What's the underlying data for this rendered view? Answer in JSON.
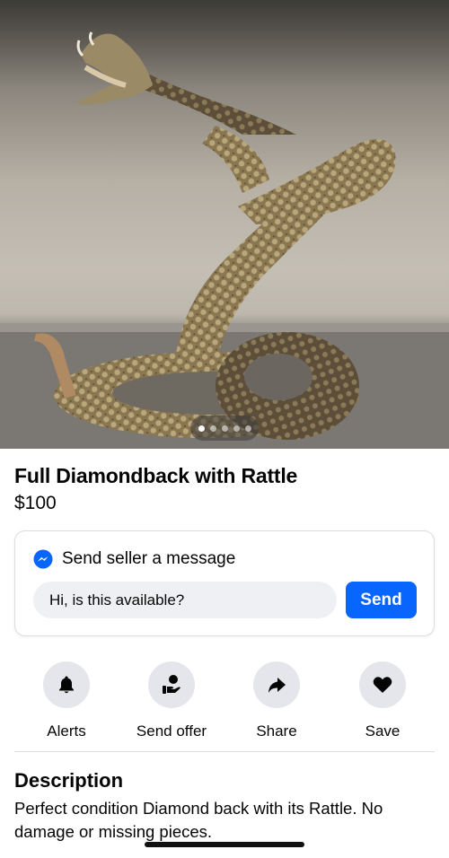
{
  "listing": {
    "photo_icon": "rattlesnake-photo",
    "carousel": {
      "total": 5,
      "active_index": 0
    },
    "title": "Full Diamondback with Rattle",
    "price": "$100"
  },
  "message": {
    "icon": "messenger-icon",
    "heading": "Send seller a message",
    "input_value": "Hi, is this available?",
    "send_label": "Send",
    "accent_color": "#0866ff"
  },
  "actions": [
    {
      "label": "Alerts",
      "icon": "bell-icon"
    },
    {
      "label": "Send offer",
      "icon": "offer-hand-icon"
    },
    {
      "label": "Share",
      "icon": "share-arrow-icon"
    },
    {
      "label": "Save",
      "icon": "heart-icon"
    }
  ],
  "description": {
    "heading": "Description",
    "body": "Perfect condition Diamond back with its Rattle. No damage or missing pieces."
  }
}
